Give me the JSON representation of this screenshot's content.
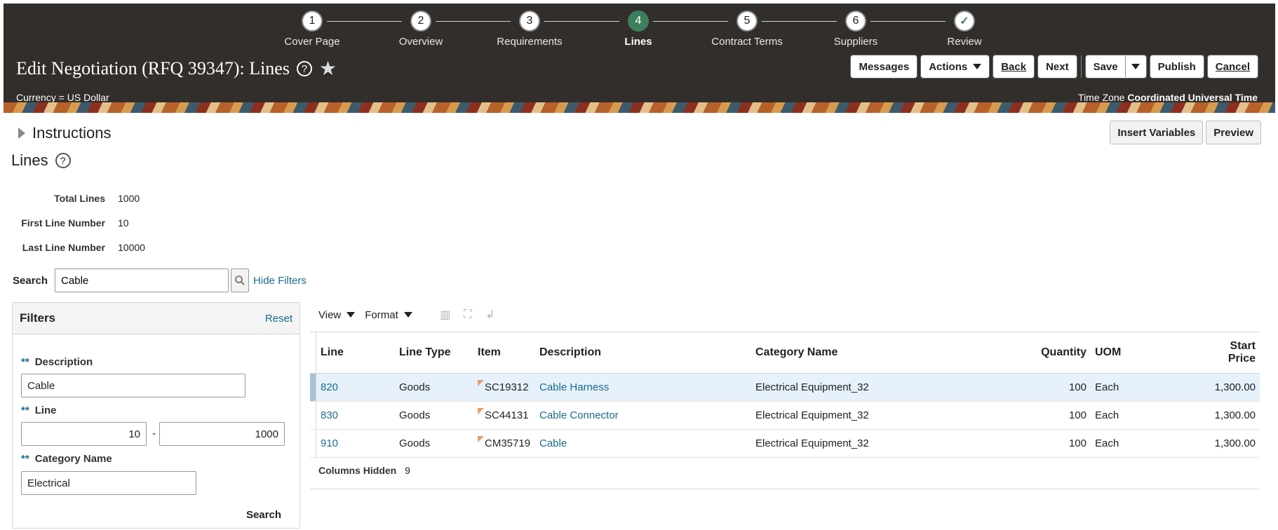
{
  "train": {
    "steps": [
      {
        "num": "1",
        "label": "Cover Page"
      },
      {
        "num": "2",
        "label": "Overview"
      },
      {
        "num": "3",
        "label": "Requirements"
      },
      {
        "num": "4",
        "label": "Lines"
      },
      {
        "num": "5",
        "label": "Contract Terms"
      },
      {
        "num": "6",
        "label": "Suppliers"
      },
      {
        "num": "✓",
        "label": "Review"
      }
    ],
    "current_index": 3
  },
  "header": {
    "title": "Edit Negotiation (RFQ 39347): Lines",
    "currency": "Currency = US Dollar",
    "timezone_label": "Time Zone",
    "timezone_value": "Coordinated Universal Time",
    "buttons": {
      "messages": "Messages",
      "actions": "Actions",
      "back": "Back",
      "next": "Next",
      "save": "Save",
      "publish": "Publish",
      "cancel": "Cancel"
    }
  },
  "instructions": {
    "label": "Instructions"
  },
  "right_buttons": {
    "insert_variables": "Insert Variables",
    "preview": "Preview"
  },
  "lines_section": {
    "title": "Lines",
    "total_lines_label": "Total Lines",
    "total_lines": "1000",
    "first_line_label": "First Line Number",
    "first_line": "10",
    "last_line_label": "Last Line Number",
    "last_line": "10000"
  },
  "search": {
    "label": "Search",
    "value": "Cable",
    "hide_filters": "Hide Filters"
  },
  "filters": {
    "title": "Filters",
    "reset": "Reset",
    "description_label": "Description",
    "description_value": "Cable",
    "line_label": "Line",
    "line_from": "10",
    "line_sep": "-",
    "line_to": "1000",
    "category_label": "Category Name",
    "category_value": "Electrical",
    "search_button": "Search",
    "required_marker": "**"
  },
  "toolbar": {
    "view": "View",
    "format": "Format"
  },
  "table": {
    "headers": {
      "line": "Line",
      "line_type": "Line Type",
      "item": "Item",
      "description": "Description",
      "category": "Category Name",
      "quantity": "Quantity",
      "uom": "UOM",
      "start_price_1": "Start",
      "start_price_2": "Price"
    },
    "rows": [
      {
        "line": "820",
        "line_type": "Goods",
        "item": "SC19312",
        "description": "Cable Harness",
        "category": "Electrical Equipment_32",
        "quantity": "100",
        "uom": "Each",
        "start_price": "1,300.00"
      },
      {
        "line": "830",
        "line_type": "Goods",
        "item": "SC44131",
        "description": "Cable Connector",
        "category": "Electrical Equipment_32",
        "quantity": "100",
        "uom": "Each",
        "start_price": "1,300.00"
      },
      {
        "line": "910",
        "line_type": "Goods",
        "item": "CM35719",
        "description": "Cable",
        "category": "Electrical Equipment_32",
        "quantity": "100",
        "uom": "Each",
        "start_price": "1,300.00"
      }
    ],
    "columns_hidden_label": "Columns Hidden",
    "columns_hidden": "9"
  },
  "colors": {
    "header_bg": "#312e2b",
    "current_step": "#3b7f5c",
    "link": "#1b6b8f",
    "selected_row": "#e6f1fb"
  }
}
